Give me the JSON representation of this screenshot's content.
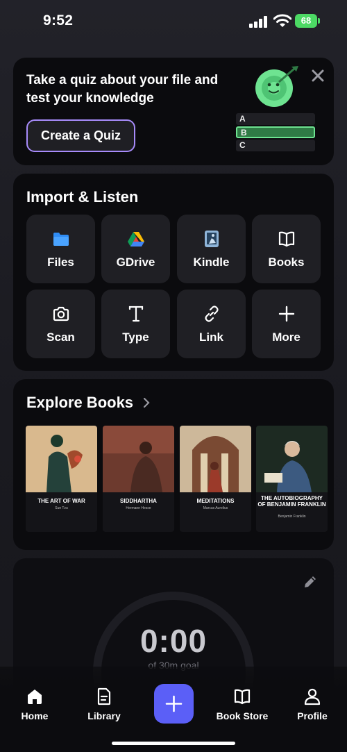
{
  "status_bar": {
    "time": "9:52",
    "battery": "68"
  },
  "quiz_card": {
    "text": "Take a quiz about your file and test your knowledge",
    "button_label": "Create a Quiz",
    "options": [
      "A",
      "B",
      "C"
    ],
    "selected_option": "B"
  },
  "import_section": {
    "title": "Import & Listen",
    "items": [
      {
        "label": "Files",
        "icon": "folder-icon"
      },
      {
        "label": "GDrive",
        "icon": "google-drive-icon"
      },
      {
        "label": "Kindle",
        "icon": "kindle-icon"
      },
      {
        "label": "Books",
        "icon": "book-open-icon"
      },
      {
        "label": "Scan",
        "icon": "camera-icon"
      },
      {
        "label": "Type",
        "icon": "text-t-icon"
      },
      {
        "label": "Link",
        "icon": "link-icon"
      },
      {
        "label": "More",
        "icon": "plus-icon"
      }
    ]
  },
  "explore_section": {
    "title": "Explore Books",
    "books": [
      {
        "title": "THE ART OF WAR",
        "author": "Sun Tzu"
      },
      {
        "title": "SIDDHARTHA",
        "author": "Hermann Hesse"
      },
      {
        "title": "MEDITATIONS",
        "author": "Marcus Aurelius"
      },
      {
        "title": "THE AUTOBIOGRAPHY OF BENJAMIN FRANKLIN",
        "author": "Benjamin Franklin"
      }
    ]
  },
  "timer_card": {
    "value": "0:00",
    "goal": "of 30m goal"
  },
  "bottom_nav": {
    "items": [
      {
        "label": "Home",
        "icon": "home-icon"
      },
      {
        "label": "Library",
        "icon": "document-icon"
      },
      {
        "label": "Book Store",
        "icon": "book-open-icon"
      },
      {
        "label": "Profile",
        "icon": "person-icon"
      }
    ],
    "fab_icon": "plus-icon"
  },
  "colors": {
    "accent": "#5b5ff7",
    "quiz_border": "#a78bfa",
    "quiz_selected": "#2f7a45",
    "battery": "#4cd964"
  }
}
